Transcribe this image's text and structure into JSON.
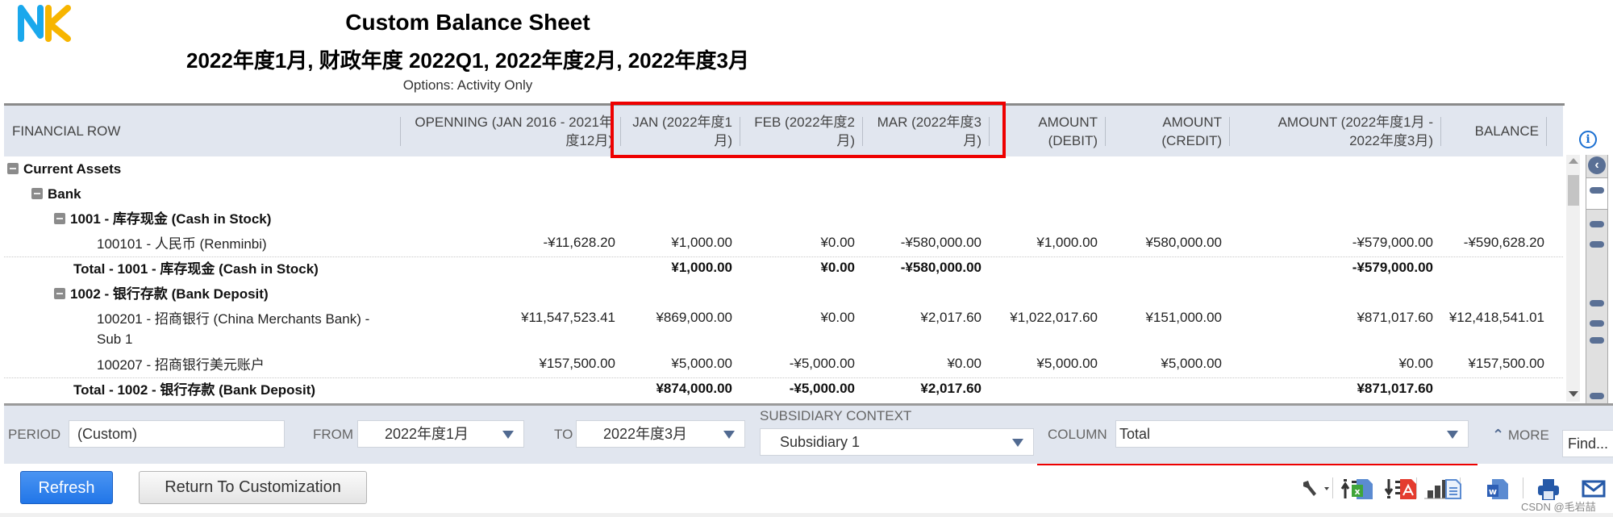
{
  "header": {
    "logo_text": "NK",
    "title": "Custom Balance Sheet",
    "period_line": "2022年度1月, 财政年度 2022Q1, 2022年度2月, 2022年度3月",
    "options": "Options: Activity Only"
  },
  "table": {
    "columns": [
      "FINANCIAL ROW",
      "OPENNING (JAN 2016 - 2021年度12月)",
      "JAN (2022年度1月)",
      "FEB (2022年度2月)",
      "MAR (2022年度3月)",
      "AMOUNT (DEBIT)",
      "AMOUNT (CREDIT)",
      "AMOUNT (2022年度1月 - 2022年度3月)",
      "BALANCE"
    ],
    "rows": [
      {
        "label": "Current Assets",
        "level": 0,
        "type": "section",
        "values": [
          "",
          "",
          "",
          "",
          "",
          "",
          "",
          ""
        ]
      },
      {
        "label": "Bank",
        "level": 1,
        "type": "section",
        "values": [
          "",
          "",
          "",
          "",
          "",
          "",
          "",
          ""
        ]
      },
      {
        "label": "1001 - 库存现金 (Cash in Stock)",
        "level": 2,
        "type": "section",
        "values": [
          "",
          "",
          "",
          "",
          "",
          "",
          "",
          ""
        ]
      },
      {
        "label": "100101 - 人民币 (Renminbi)",
        "level": 3,
        "type": "detail",
        "values": [
          "-¥11,628.20",
          "¥1,000.00",
          "¥0.00",
          "-¥580,000.00",
          "¥1,000.00",
          "¥580,000.00",
          "-¥579,000.00",
          "-¥590,628.20"
        ]
      },
      {
        "label": "Total - 1001 - 库存现金 (Cash in Stock)",
        "level": 2,
        "type": "total",
        "values": [
          "",
          "¥1,000.00",
          "¥0.00",
          "-¥580,000.00",
          "",
          "",
          "-¥579,000.00",
          ""
        ]
      },
      {
        "label": "1002 - 银行存款 (Bank Deposit)",
        "level": 2,
        "type": "section",
        "values": [
          "",
          "",
          "",
          "",
          "",
          "",
          "",
          ""
        ]
      },
      {
        "label": "100201 - 招商银行 (China Merchants Bank) - Sub 1",
        "level": 3,
        "type": "detail",
        "values": [
          "¥11,547,523.41",
          "¥869,000.00",
          "¥0.00",
          "¥2,017.60",
          "¥1,022,017.60",
          "¥151,000.00",
          "¥871,017.60",
          "¥12,418,541.01"
        ]
      },
      {
        "label": "100207 - 招商银行美元账户",
        "level": 3,
        "type": "detail",
        "values": [
          "¥157,500.00",
          "¥5,000.00",
          "-¥5,000.00",
          "¥0.00",
          "¥5,000.00",
          "¥5,000.00",
          "¥0.00",
          "¥157,500.00"
        ]
      },
      {
        "label": "Total - 1002 - 银行存款 (Bank Deposit)",
        "level": 2,
        "type": "total",
        "values": [
          "",
          "¥874,000.00",
          "-¥5,000.00",
          "¥2,017.60",
          "",
          "",
          "¥871,017.60",
          ""
        ]
      }
    ]
  },
  "filters": {
    "period_label": "PERIOD",
    "period_value": "(Custom)",
    "from_label": "FROM",
    "from_value": "2022年度1月",
    "to_label": "TO",
    "to_value": "2022年度3月",
    "subsidiary_label": "SUBSIDIARY CONTEXT",
    "subsidiary_value": "Subsidiary 1",
    "column_label": "COLUMN",
    "column_value": "Total",
    "more_label": "MORE",
    "find_placeholder": "Find..."
  },
  "buttons": {
    "refresh": "Refresh",
    "return": "Return To Customization"
  },
  "toolbar": {
    "icons": [
      "wrench-icon",
      "collapse-all-icon",
      "expand-all-icon",
      "chart-icon",
      "excel-icon",
      "pdf-icon",
      "document-icon",
      "word-icon",
      "print-icon",
      "email-icon"
    ]
  },
  "colors": {
    "highlight": "#ee0000",
    "header_bg": "#e1e6ef",
    "primary_button": "#2176e8",
    "logo_n": "#1aa8ec",
    "logo_k": "#f7b500"
  },
  "watermark": "CSDN @毛岩喆"
}
